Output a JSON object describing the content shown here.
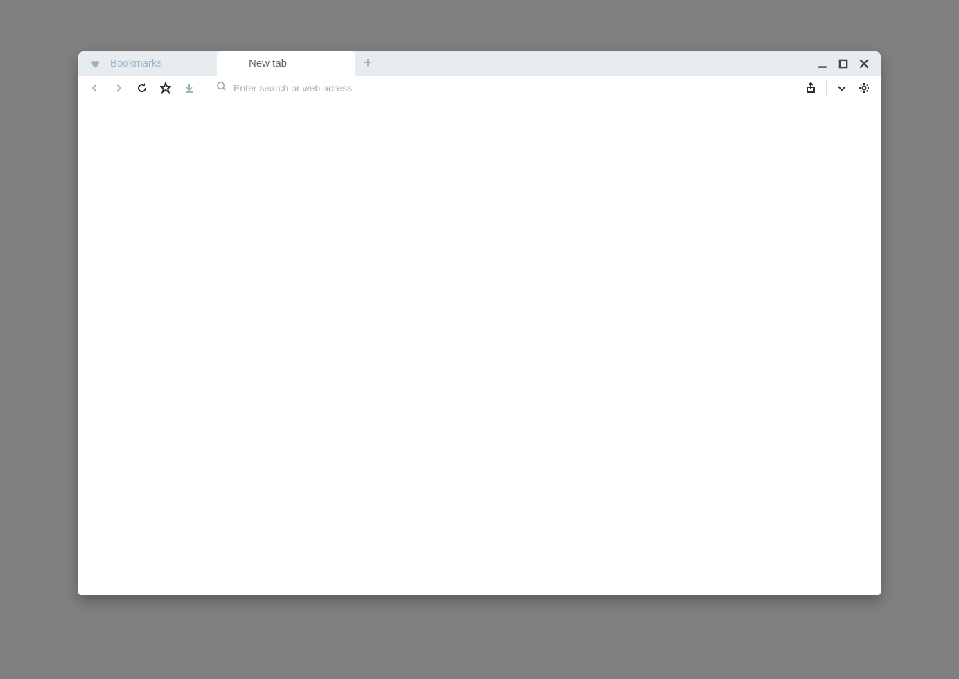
{
  "tabs": {
    "bookmarks": {
      "label": "Bookmarks",
      "icon": "heart-icon",
      "active": false
    },
    "newtab": {
      "label": "New tab",
      "icon": "grid-icon",
      "active": true
    }
  },
  "addressbar": {
    "placeholder": "Enter search or web adress",
    "value": ""
  },
  "icons": {
    "back": "chevron-left-icon",
    "forward": "chevron-right-icon",
    "reload": "reload-icon",
    "bookmark": "star-icon",
    "download": "download-icon",
    "search": "search-icon",
    "share": "share-icon",
    "more": "chevron-down-icon",
    "settings": "gear-icon",
    "minimize": "minimize-icon",
    "maximize": "maximize-icon",
    "close": "close-icon",
    "newtab": "plus-icon"
  },
  "colors": {
    "tabbar_bg": "#e6ecf0",
    "inactive_text": "#9fb1bc",
    "active_text": "#5a6570",
    "dark_icon": "#2a2e33",
    "page_bg": "#808080",
    "content_bg": "#ffffff"
  }
}
